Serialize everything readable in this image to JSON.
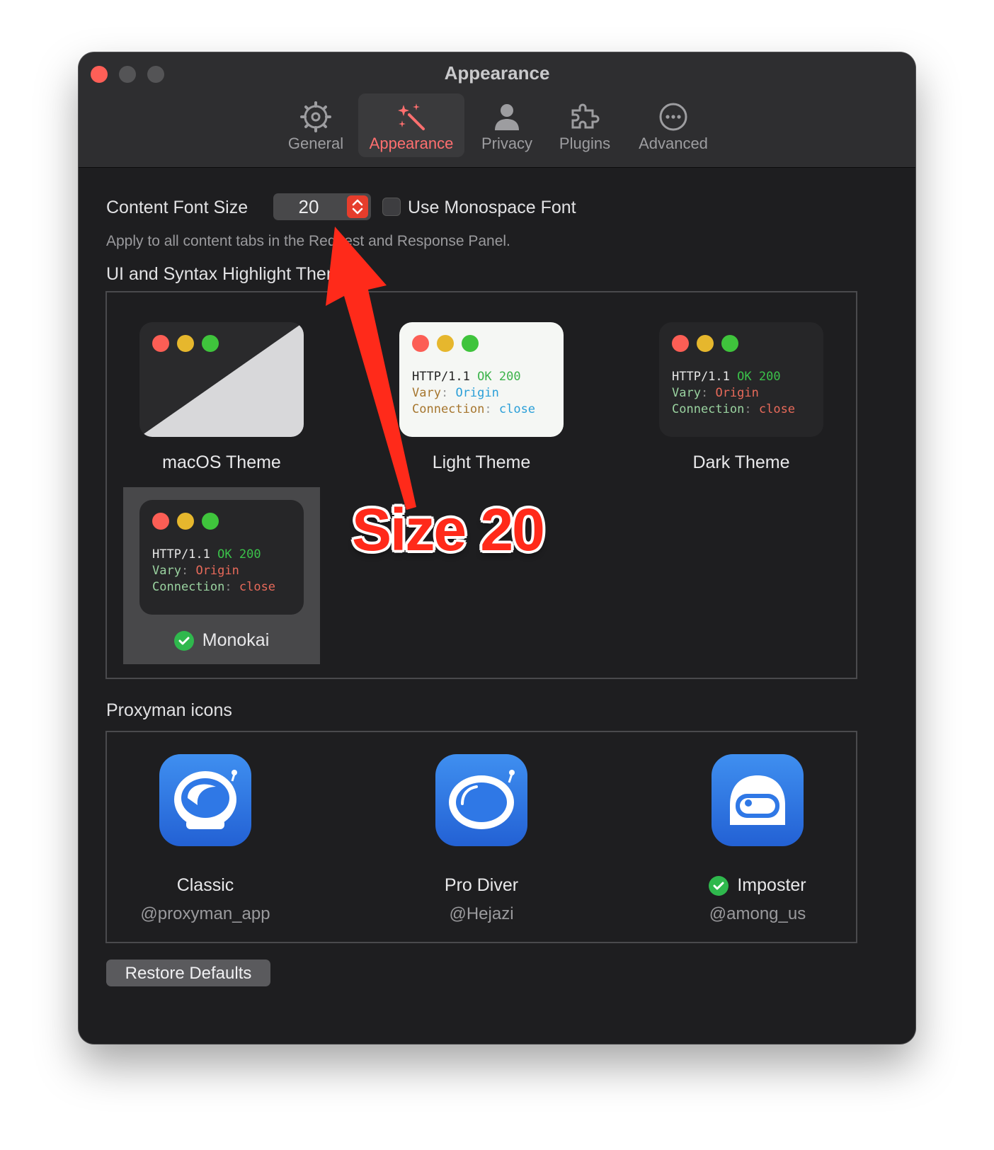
{
  "window": {
    "title": "Appearance"
  },
  "toolbar": {
    "tabs": [
      {
        "label": "General",
        "icon": "gear-icon"
      },
      {
        "label": "Appearance",
        "icon": "magic-wand-icon",
        "active": true
      },
      {
        "label": "Privacy",
        "icon": "person-icon"
      },
      {
        "label": "Plugins",
        "icon": "puzzle-icon"
      },
      {
        "label": "Advanced",
        "icon": "ellipsis-circle-icon"
      }
    ],
    "active_color": "#ff6f6f"
  },
  "font": {
    "label": "Content Font Size",
    "value": "20",
    "monospace_label": "Use Monospace Font",
    "monospace_checked": false,
    "hint": "Apply to all content tabs in the Request and Response Panel."
  },
  "theme_section": {
    "title": "UI and Syntax Highlight Theme",
    "themes": [
      {
        "name": "macOS Theme"
      },
      {
        "name": "Light Theme",
        "code": [
          "HTTP/1.1",
          "OK",
          "200",
          "Vary",
          ":",
          "Origin",
          "Connection",
          ":",
          "close"
        ]
      },
      {
        "name": "Dark Theme",
        "code": [
          "HTTP/1.1",
          "OK",
          "200",
          "Vary",
          ":",
          "Origin",
          "Connection",
          ":",
          "close"
        ]
      },
      {
        "name": "Monokai",
        "selected": true,
        "code": [
          "HTTP/1.1",
          "OK",
          "200",
          "Vary",
          ":",
          "Origin",
          "Connection",
          ":",
          "close"
        ]
      }
    ]
  },
  "icons_section": {
    "title": "Proxyman icons",
    "icons": [
      {
        "name": "Classic",
        "author": "@proxyman_app"
      },
      {
        "name": "Pro Diver",
        "author": "@Hejazi"
      },
      {
        "name": "Imposter",
        "author": "@among_us",
        "selected": true
      }
    ]
  },
  "restore_label": "Restore Defaults",
  "annotation": {
    "text": "Size 20",
    "color": "#ff2a1a"
  }
}
